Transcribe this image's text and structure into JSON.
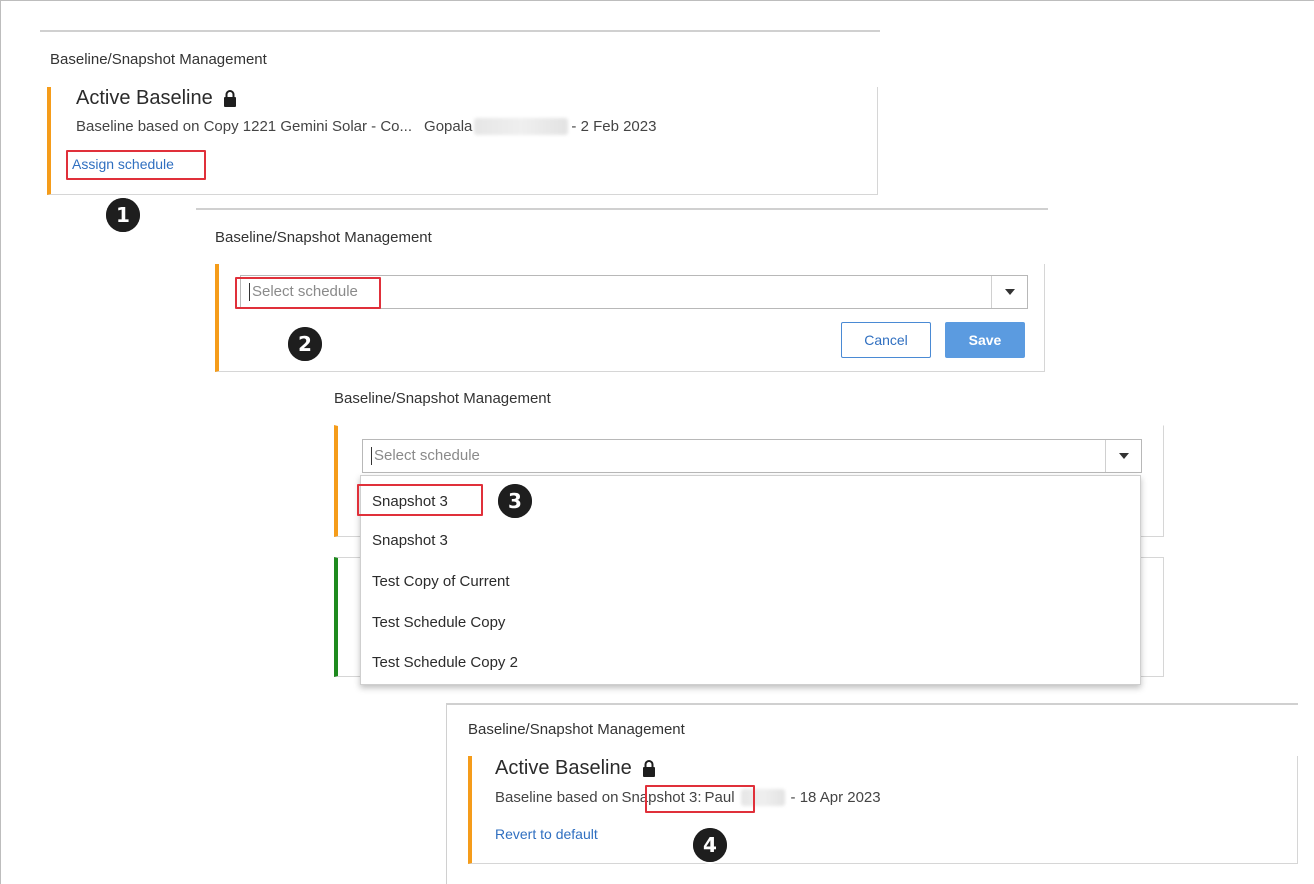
{
  "panel1": {
    "title": "Baseline/Snapshot Management",
    "heading": "Active Baseline",
    "subtitle_prefix": "Baseline based on Copy 1221 Gemini Solar - Co...",
    "user_first": "Gopala",
    "date": "- 2 Feb 2023",
    "link": "Assign schedule",
    "badge": "1"
  },
  "panel2": {
    "title": "Baseline/Snapshot Management",
    "select_placeholder": "Select schedule",
    "cancel_label": "Cancel",
    "save_label": "Save",
    "badge": "2"
  },
  "panel3": {
    "title": "Baseline/Snapshot Management",
    "select_placeholder": "Select schedule",
    "options": [
      "Snapshot 3",
      "Snapshot 3",
      "Test Copy of Current",
      "Test Schedule Copy",
      "Test Schedule Copy 2"
    ],
    "badge": "3"
  },
  "panel4": {
    "title": "Baseline/Snapshot Management",
    "heading": "Active Baseline",
    "subtitle_prefix": "Baseline based on",
    "snapshot": "Snapshot 3:",
    "user_first": "Paul",
    "date": "- 18 Apr 2023",
    "link": "Revert to default",
    "badge": "4"
  },
  "colors": {
    "accent_orange": "#f59c1a",
    "accent_green": "#1e8a1e",
    "link_blue": "#2f6fc0",
    "highlight_red": "#e0303a",
    "save_blue": "#5b9be0"
  },
  "icons": {
    "lock": "lock-icon",
    "caret": "chevron-down-icon"
  }
}
